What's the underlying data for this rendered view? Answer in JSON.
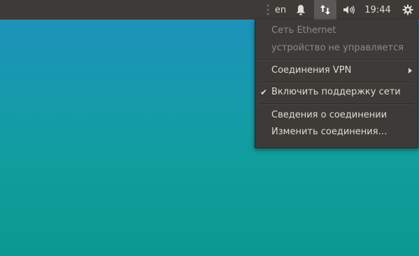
{
  "panel": {
    "language": "en",
    "clock": "19:44",
    "icons": [
      "drag-handle-icon",
      "bell-icon",
      "network-icon",
      "volume-icon",
      "gear-icon"
    ]
  },
  "network_menu": {
    "ethernet_title": "Сеть Ethernet",
    "ethernet_status": "устройство не управляется",
    "vpn_connections": "Соединения VPN",
    "enable_networking": "Включить поддержку сети",
    "enable_networking_checked": true,
    "connection_info": "Сведения о соединении",
    "edit_connections": "Изменить соединения…"
  },
  "colors": {
    "panel_bg": "#3c3b37",
    "desktop_top": "#1f8fbe",
    "desktop_bottom": "#0b9891",
    "text": "#dfdbd2",
    "disabled_text": "#8c8a85"
  }
}
